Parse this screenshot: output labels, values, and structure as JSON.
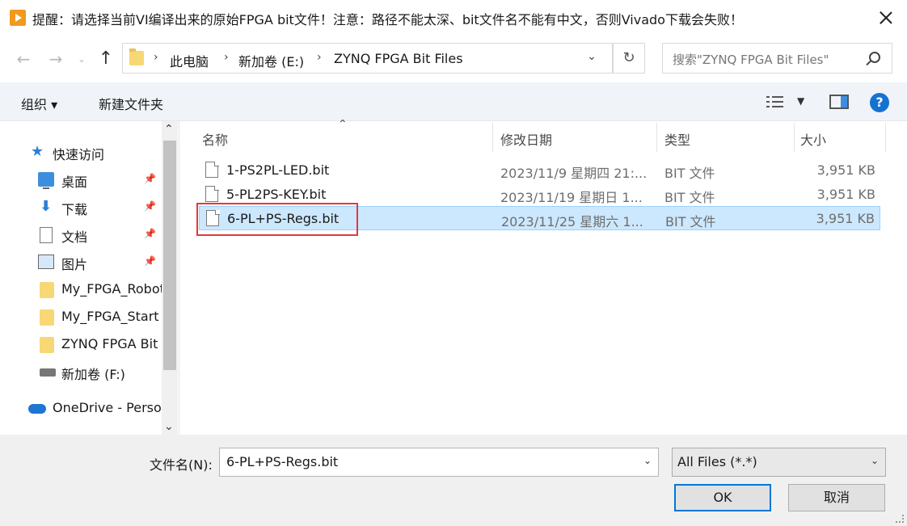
{
  "window": {
    "title": "提醒：请选择当前VI编译出来的原始FPGA bit文件！注意：路径不能太深、bit文件名不能有中文，否则Vivado下载会失败！"
  },
  "nav": {
    "back_icon": "arrow-left-icon",
    "forward_icon": "arrow-right-icon",
    "up_icon": "arrow-up-icon",
    "breadcrumbs": [
      "此电脑",
      "新加卷 (E:)",
      "ZYNQ FPGA Bit Files"
    ],
    "search_placeholder": "搜索\"ZYNQ FPGA Bit Files\""
  },
  "toolbar": {
    "organize_label": "组织 ▾",
    "new_folder_label": "新建文件夹"
  },
  "sidebar": {
    "quick_access": "快速访问",
    "items": [
      {
        "label": "桌面",
        "icon": "desktop-icon",
        "pinned": true
      },
      {
        "label": "下载",
        "icon": "download-icon",
        "pinned": true
      },
      {
        "label": "文档",
        "icon": "document-icon",
        "pinned": true
      },
      {
        "label": "图片",
        "icon": "pictures-icon",
        "pinned": true
      },
      {
        "label": "My_FPGA_Robot",
        "icon": "folder-icon",
        "pinned": false
      },
      {
        "label": "My_FPGA_Start",
        "icon": "folder-icon",
        "pinned": false
      },
      {
        "label": "ZYNQ FPGA Bit",
        "icon": "folder-icon",
        "pinned": false
      },
      {
        "label": "新加卷 (F:)",
        "icon": "drive-icon",
        "pinned": false
      }
    ],
    "onedrive": "OneDrive - Personal"
  },
  "filelist": {
    "columns": [
      "名称",
      "修改日期",
      "类型",
      "大小"
    ],
    "rows": [
      {
        "name": "1-PS2PL-LED.bit",
        "date": "2023/11/9 星期四 21:...",
        "type": "BIT 文件",
        "size": "3,951 KB",
        "selected": false
      },
      {
        "name": "5-PL2PS-KEY.bit",
        "date": "2023/11/19 星期日 1...",
        "type": "BIT 文件",
        "size": "3,951 KB",
        "selected": false
      },
      {
        "name": "6-PL+PS-Regs.bit",
        "date": "2023/11/25 星期六 1...",
        "type": "BIT 文件",
        "size": "3,951 KB",
        "selected": true
      }
    ]
  },
  "bottom": {
    "filename_label": "文件名(N):",
    "filename_value": "6-PL+PS-Regs.bit",
    "filetype_value": "All Files (*.*)",
    "ok_label": "OK",
    "cancel_label": "取消"
  },
  "colors": {
    "selection": "#cce8ff",
    "highlight_box": "#e53935",
    "accent": "#0078d7"
  }
}
